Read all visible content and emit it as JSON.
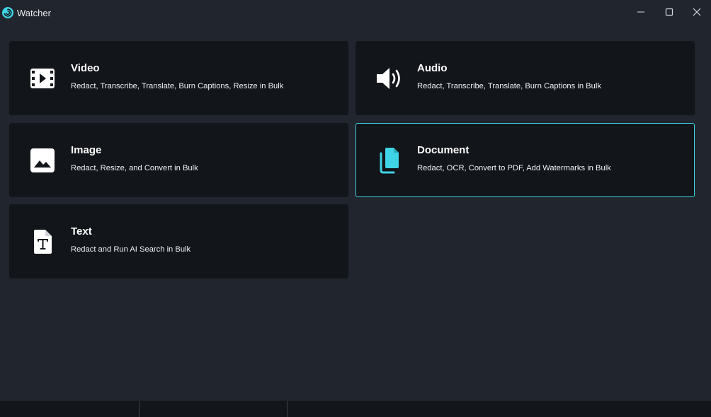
{
  "window": {
    "title": "Watcher",
    "logo_icon": "watcher-swirl-logo",
    "controls": [
      "minimize-icon",
      "maximize-icon",
      "close-icon"
    ]
  },
  "colors": {
    "background": "#21252e",
    "card": "#12151a",
    "accent": "#3fd4e5"
  },
  "cards": [
    {
      "title": "Video",
      "description": "Redact, Transcribe, Translate, Burn Captions, Resize in Bulk",
      "icon": "film-icon",
      "selected": false
    },
    {
      "title": "Audio",
      "description": "Redact, Transcribe, Translate, Burn Captions in Bulk",
      "icon": "speaker-icon",
      "selected": false
    },
    {
      "title": "Image",
      "description": "Redact, Resize, and Convert in Bulk",
      "icon": "image-icon",
      "selected": false
    },
    {
      "title": "Document",
      "description": "Redact, OCR, Convert to PDF, Add Watermarks in Bulk",
      "icon": "documents-icon",
      "selected": true
    },
    {
      "title": "Text",
      "description": "Redact and Run AI Search in Bulk",
      "icon": "text-file-icon",
      "selected": false
    }
  ],
  "status_bar": {
    "segments": [
      "",
      "",
      ""
    ]
  }
}
